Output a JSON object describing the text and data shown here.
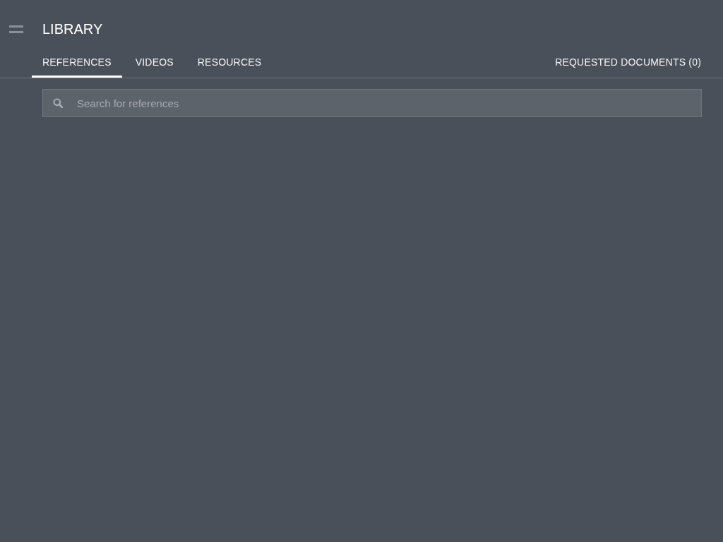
{
  "header": {
    "title": "LIBRARY"
  },
  "tabs": [
    {
      "label": "REFERENCES",
      "selected": true
    },
    {
      "label": "VIDEOS",
      "selected": false
    },
    {
      "label": "RESOURCES",
      "selected": false
    }
  ],
  "requested_documents": {
    "label": "REQUESTED DOCUMENTS (0)"
  },
  "search": {
    "placeholder": "Search for references"
  }
}
